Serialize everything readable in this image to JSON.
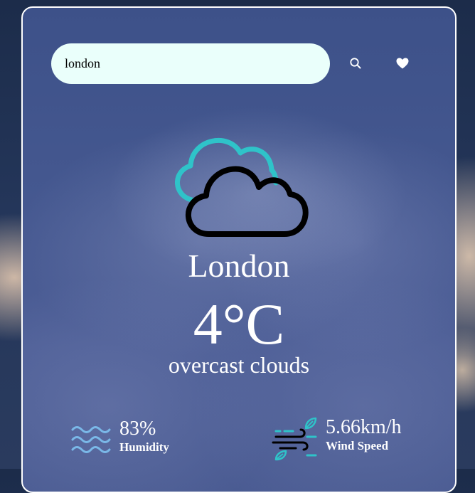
{
  "search": {
    "value": "london",
    "button_icon": "search-icon",
    "favorite_icon": "heart-icon"
  },
  "weather": {
    "icon": "cloudy-icon",
    "city": "London",
    "temperature": "4°C",
    "description": "overcast clouds"
  },
  "stats": {
    "humidity": {
      "value": "83%",
      "label": "Humidity",
      "icon": "humidity-waves-icon"
    },
    "wind": {
      "value": "5.66km/h",
      "label": "Wind Speed",
      "icon": "wind-icon"
    }
  },
  "colors": {
    "accent_teal": "#2fc3c9",
    "input_bg": "#eafffb",
    "humidity_blue": "#7ab8e8"
  }
}
